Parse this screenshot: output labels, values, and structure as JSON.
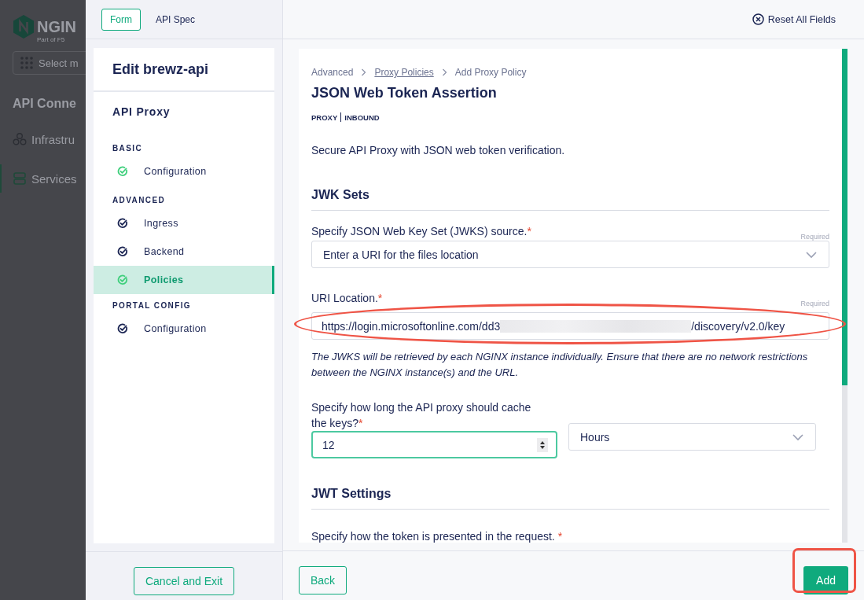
{
  "background_app": {
    "logo_text": "NGIN",
    "logo_subtitle": "Part of F5",
    "search_placeholder": "Select m",
    "heading": "API Conne",
    "nav": [
      {
        "label": "Infrastru",
        "selected": false
      },
      {
        "label": "Services",
        "selected": true
      }
    ]
  },
  "mode_tabs": [
    {
      "label": "Form",
      "selected": true
    },
    {
      "label": "API Spec",
      "selected": false
    }
  ],
  "sidebar": {
    "title": "Edit brewz-api",
    "subtitle": "API Proxy",
    "sections": [
      {
        "label": "BASIC",
        "items": [
          {
            "label": "Configuration",
            "complete": true,
            "selected": false
          }
        ]
      },
      {
        "label": "ADVANCED",
        "items": [
          {
            "label": "Ingress",
            "complete": false,
            "selected": false
          },
          {
            "label": "Backend",
            "complete": false,
            "selected": false
          },
          {
            "label": "Policies",
            "complete": true,
            "selected": true
          }
        ]
      },
      {
        "label": "PORTAL CONFIG",
        "items": [
          {
            "label": "Configuration",
            "complete": false,
            "selected": false
          }
        ]
      }
    ]
  },
  "cancel_button": "Cancel and Exit",
  "reset_button": "Reset All Fields",
  "breadcrumb": [
    {
      "label": "Advanced",
      "link": false
    },
    {
      "label": "Proxy Policies",
      "link": true
    },
    {
      "label": "Add Proxy Policy",
      "link": false
    }
  ],
  "title": "JSON Web Token Assertion",
  "tags": [
    "PROXY",
    "INBOUND"
  ],
  "description": "Secure API Proxy with JSON web token verification.",
  "sections": [
    {
      "heading": "JWK Sets",
      "fields": [
        {
          "kind": "select",
          "label": "Specify JSON Web Key Set (JWKS) source.",
          "required_mark": "*",
          "hint": "Required",
          "value": "Enter a URI for the files location"
        },
        {
          "kind": "uri",
          "label": "URI Location.",
          "required_mark": "*",
          "hint": "Required",
          "value_start": "https://login.microsoftonline.com/dd3",
          "value_end": "/discovery/v2.0/key",
          "help": "The JWKS will be retrieved by each NGINX instance individually. Ensure that there are no network restrictions between the NGINX instance(s) and the URL."
        },
        {
          "kind": "duration",
          "label": "Specify how long the API proxy should cache the keys?",
          "required_mark": "*",
          "value": "12",
          "unit": "Hours"
        }
      ]
    },
    {
      "heading": "JWT Settings",
      "fields": [
        {
          "kind": "text",
          "label": "Specify how the token is presented in the request.",
          "required_mark": "*"
        }
      ]
    }
  ],
  "back_button": "Back",
  "add_button": "Add"
}
